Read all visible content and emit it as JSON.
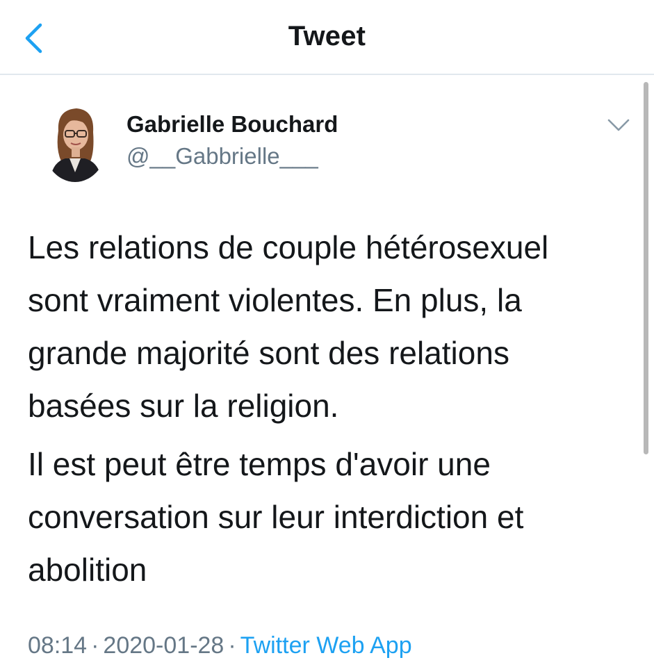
{
  "colors": {
    "accent": "#1da1f2",
    "text_primary": "#14171a",
    "text_secondary": "#657786",
    "divider": "#e1e8ed"
  },
  "header": {
    "back_icon": "chevron-left-icon",
    "title": "Tweet"
  },
  "tweet": {
    "author": {
      "name": "Gabrielle Bouchard",
      "handle": "@__Gabbrielle___",
      "avatar": "profile-photo"
    },
    "menu_icon": "chevron-down-icon",
    "paragraphs": [
      "Les relations de couple hétérosexuel\nsont vraiment violentes. En plus, la\ngrande majorité sont des relations\nbasées sur la religion.",
      "Il est peut être temps d'avoir une\nconversation sur leur interdiction et\nabolition"
    ],
    "time": "08:14",
    "separator": "·",
    "date": "2020-01-28",
    "source": "Twitter Web App"
  }
}
